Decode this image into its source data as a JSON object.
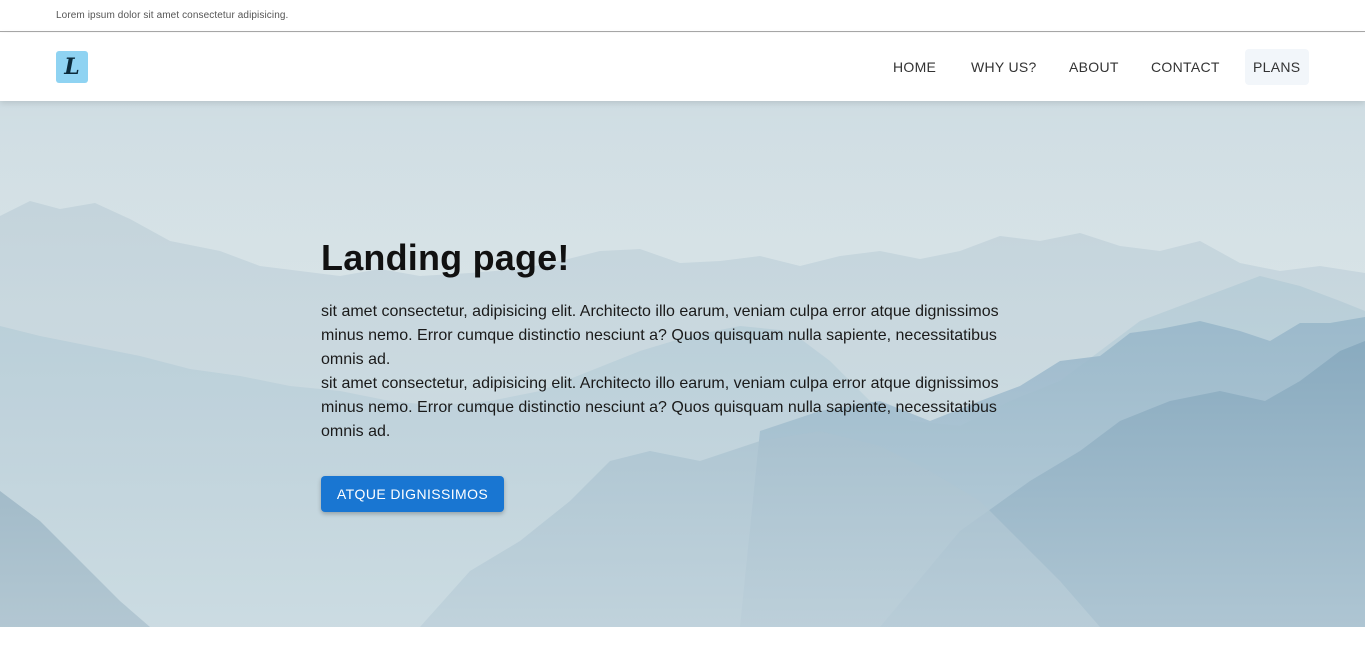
{
  "topbar": {
    "text": "Lorem ipsum dolor sit amet consectetur adipisicing."
  },
  "logo": {
    "letter": "L",
    "background": "#8fd3f2"
  },
  "nav": {
    "items": [
      {
        "label": "HOME"
      },
      {
        "label": "WHY US?"
      },
      {
        "label": "ABOUT"
      },
      {
        "label": "CONTACT"
      },
      {
        "label": "PLANS",
        "active": true
      }
    ]
  },
  "hero": {
    "title": "Landing page!",
    "paragraphs": [
      "sit amet consectetur, adipisicing elit. Architecto illo earum, veniam culpa error atque dignissimos minus nemo. Error cumque distinctio nesciunt a? Quos quisquam nulla sapiente, necessitatibus omnis ad.",
      "sit amet consectetur, adipisicing elit. Architecto illo earum, veniam culpa error atque dignissimos minus nemo. Error cumque distinctio nesciunt a? Quos quisquam nulla sapiente, necessitatibus omnis ad."
    ],
    "cta_label": "ATQUE DIGNISSIMOS",
    "background_image": "misty-mountains"
  },
  "colors": {
    "accent": "#1976d2",
    "text": "#111111"
  }
}
